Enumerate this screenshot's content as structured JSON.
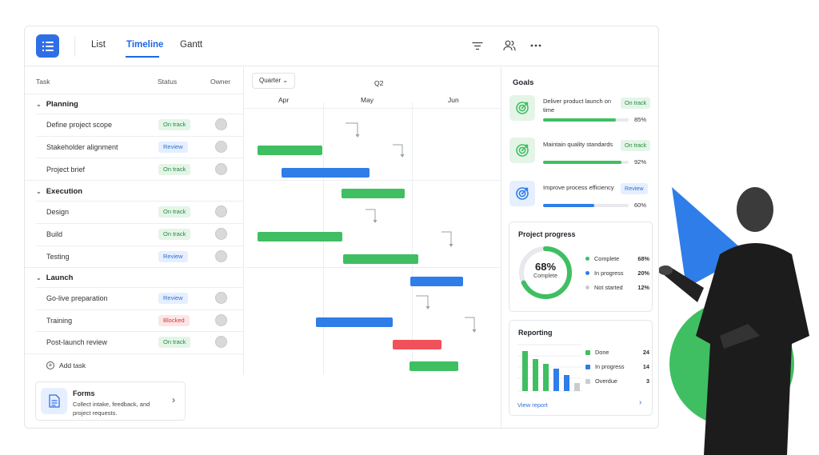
{
  "app": {
    "tabs": [
      {
        "label": "List",
        "active": false
      },
      {
        "label": "Timeline",
        "active": true
      },
      {
        "label": "Gantt",
        "active": false
      }
    ],
    "toolbar_icons": [
      "filter-icon",
      "people-icon",
      "more-icon"
    ]
  },
  "tasks_table": {
    "headers": {
      "task": "Task",
      "status": "Status",
      "owner": "Owner"
    },
    "groups": [
      {
        "name": "Planning",
        "rows": [
          {
            "name": "Define project scope",
            "status": "On track",
            "kind": "ok"
          },
          {
            "name": "Stakeholder alignment",
            "status": "Review",
            "kind": "rev"
          },
          {
            "name": "Project brief",
            "status": "On track",
            "kind": "ok"
          }
        ]
      },
      {
        "name": "Execution",
        "rows": [
          {
            "name": "Design",
            "status": "On track",
            "kind": "ok"
          },
          {
            "name": "Build",
            "status": "On track",
            "kind": "ok"
          },
          {
            "name": "Testing",
            "status": "Review",
            "kind": "rev"
          }
        ]
      },
      {
        "name": "Launch",
        "rows": [
          {
            "name": "Go-live preparation",
            "status": "Review",
            "kind": "rev"
          },
          {
            "name": "Training",
            "status": "Blocked",
            "kind": "blk"
          },
          {
            "name": "Post-launch review",
            "status": "On track",
            "kind": "ok"
          }
        ]
      }
    ],
    "add_task_label": "Add task"
  },
  "forms_card": {
    "title": "Forms",
    "description": "Collect intake, feedback, and project requests."
  },
  "timeline": {
    "range_select": "Quarter",
    "quarter": "Q2",
    "months": [
      "Apr",
      "May",
      "Jun"
    ]
  },
  "goals": {
    "title": "Goals",
    "items": [
      {
        "name": "Deliver product launch on time",
        "status": "On track",
        "kind": "ok",
        "progress": 85,
        "progress_label": "85%"
      },
      {
        "name": "Maintain quality standards",
        "status": "On track",
        "kind": "ok",
        "progress": 92,
        "progress_label": "92%"
      },
      {
        "name": "Improve process efficiency",
        "status": "Review",
        "kind": "rev",
        "progress": 60,
        "progress_label": "60%"
      }
    ]
  },
  "project_progress": {
    "title": "Project progress",
    "center_value": "68%",
    "center_label": "Complete",
    "legend": [
      {
        "label": "Complete",
        "value": "68%",
        "color": "#3fbf62"
      },
      {
        "label": "In progress",
        "value": "20%",
        "color": "#2f7de8"
      },
      {
        "label": "Not started",
        "value": "12%",
        "color": "#c9cdd2"
      }
    ]
  },
  "reporting": {
    "title": "Reporting",
    "legend": [
      {
        "label": "Done",
        "value": "24",
        "color": "#3fbf62"
      },
      {
        "label": "In progress",
        "value": "14",
        "color": "#2f7de8"
      },
      {
        "label": "Overdue",
        "value": "3",
        "color": "#c9cdd2"
      }
    ],
    "view_report_label": "View report"
  },
  "colors": {
    "accent": "#1f66e5",
    "green": "#3fbf62",
    "blue": "#2f7de8",
    "red": "#f0515a"
  }
}
